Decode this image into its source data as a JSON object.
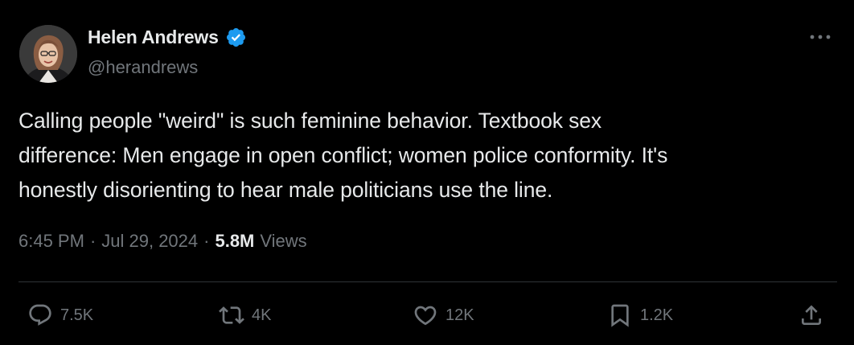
{
  "author": {
    "display_name": "Helen Andrews",
    "handle": "@herandrews",
    "verified": true
  },
  "tweet": {
    "lines": [
      "Calling people \"weird\" is such feminine behavior. Textbook sex",
      "difference: Men engage in open conflict; women police conformity. It's",
      "honestly disorienting to hear male politicians use the line."
    ]
  },
  "meta": {
    "time": "6:45 PM",
    "separator": "·",
    "date": "Jul 29, 2024",
    "views_count": "5.8M",
    "views_label": "Views"
  },
  "actions": {
    "replies": "7.5K",
    "reposts": "4K",
    "likes": "12K",
    "bookmarks": "1.2K"
  },
  "icons": {
    "more": "more-horizontal-icon",
    "verified": "verified-badge-icon",
    "reply": "reply-icon",
    "repost": "repost-icon",
    "like": "heart-icon",
    "bookmark": "bookmark-icon",
    "share": "share-icon"
  },
  "colors": {
    "background": "#000000",
    "text": "#e7e9ea",
    "secondary": "#71767b",
    "divider": "#2f3336",
    "verified": "#1d9bf0"
  }
}
